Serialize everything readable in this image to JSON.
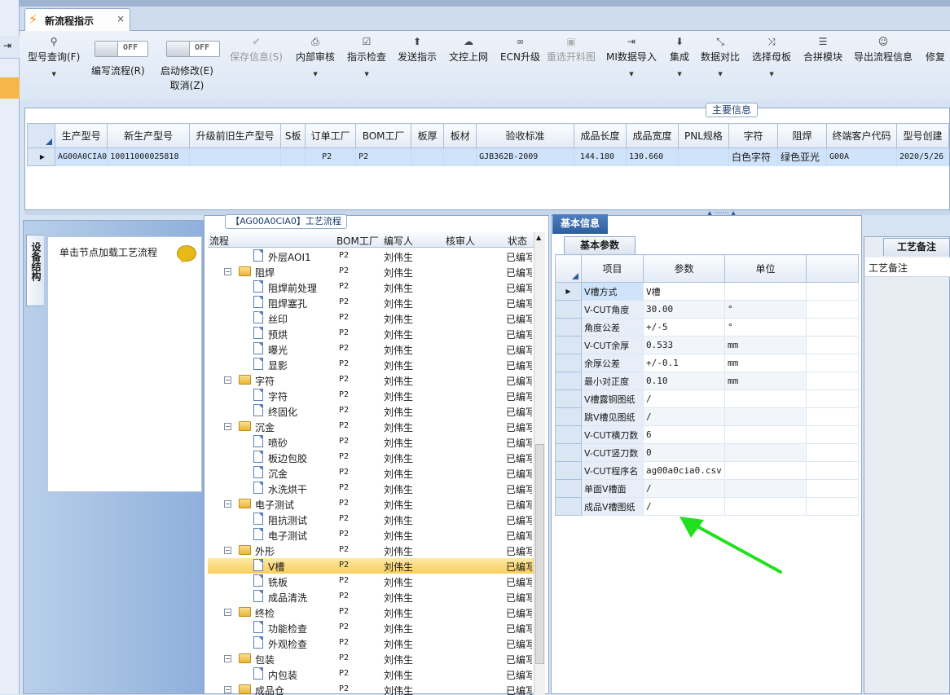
{
  "window": {
    "tab_title": "新流程指示",
    "tab_close": "×"
  },
  "toolbar": {
    "items": [
      {
        "label": "型号查询(F)",
        "icon": "search-icon"
      },
      {
        "label": "编写流程(R)",
        "icon": "toggle"
      },
      {
        "label": "启动修改(E)",
        "label2": "取消(Z)",
        "icon": "toggle"
      },
      {
        "label": "保存信息(S)",
        "icon": "check-icon",
        "disabled": true
      },
      {
        "label": "内部审核",
        "icon": "print-icon"
      },
      {
        "label": "指示检查",
        "icon": "checklist-icon"
      },
      {
        "label": "发送指示",
        "icon": "upload-icon"
      },
      {
        "label": "文控上网",
        "icon": "cloud-upload-icon"
      },
      {
        "label": "ECN升级",
        "icon": "binoculars-icon"
      },
      {
        "label": "重选开料图",
        "icon": "image-icon",
        "disabled": true
      },
      {
        "label": "MI数据导入",
        "icon": "import-icon"
      },
      {
        "label": "集成",
        "icon": "download-icon"
      },
      {
        "label": "数据对比",
        "icon": "compare-icon"
      },
      {
        "label": "选择母板",
        "icon": "shuffle-icon"
      },
      {
        "label": "合拼模块",
        "icon": "list-icon"
      },
      {
        "label": "导出流程信息",
        "icon": "smile-icon"
      },
      {
        "label": "修复",
        "icon": ""
      }
    ],
    "toggle_state": "OFF"
  },
  "main_info": {
    "title": "主要信息",
    "columns": [
      "生产型号",
      "新生产型号",
      "升级前旧生产型号",
      "S板",
      "订单工厂",
      "BOM工厂",
      "板厚",
      "板材",
      "验收标准",
      "成品长度",
      "成品宽度",
      "PNL规格",
      "字符",
      "阻焊",
      "终端客户代码",
      "型号创建"
    ],
    "row": [
      "AG00A0CIA0",
      "10011000025818",
      "",
      "",
      "P2",
      "P2",
      "",
      "",
      "GJB362B-2009",
      "144.180",
      "130.660",
      "",
      "白色字符",
      "绿色亚光",
      "G00A",
      "2020/5/26"
    ]
  },
  "left": {
    "side_tab": "设备结构",
    "node_hint": "单击节点加载工艺流程"
  },
  "process": {
    "title": "【AG00A0CIA0】工艺流程",
    "headers": [
      "流程",
      "BOM工厂",
      "编写人",
      "核审人",
      "状态"
    ],
    "rows": [
      {
        "name": "外层AOI1",
        "level": 2,
        "bom": "P2",
        "writer": "刘伟生",
        "status": "已编写"
      },
      {
        "name": "阻焊",
        "level": 1,
        "bom": "P2",
        "writer": "刘伟生",
        "status": "已编写"
      },
      {
        "name": "阻焊前处理",
        "level": 2,
        "bom": "P2",
        "writer": "刘伟生",
        "status": "已编写"
      },
      {
        "name": "阻焊塞孔",
        "level": 2,
        "bom": "P2",
        "writer": "刘伟生",
        "status": "已编写"
      },
      {
        "name": "丝印",
        "level": 2,
        "bom": "P2",
        "writer": "刘伟生",
        "status": "已编写"
      },
      {
        "name": "预烘",
        "level": 2,
        "bom": "P2",
        "writer": "刘伟生",
        "status": "已编写"
      },
      {
        "name": "曝光",
        "level": 2,
        "bom": "P2",
        "writer": "刘伟生",
        "status": "已编写"
      },
      {
        "name": "显影",
        "level": 2,
        "bom": "P2",
        "writer": "刘伟生",
        "status": "已编写"
      },
      {
        "name": "字符",
        "level": 1,
        "bom": "P2",
        "writer": "刘伟生",
        "status": "已编写"
      },
      {
        "name": "字符",
        "level": 2,
        "bom": "P2",
        "writer": "刘伟生",
        "status": "已编写"
      },
      {
        "name": "终固化",
        "level": 2,
        "bom": "P2",
        "writer": "刘伟生",
        "status": "已编写"
      },
      {
        "name": "沉金",
        "level": 1,
        "bom": "P2",
        "writer": "刘伟生",
        "status": "已编写"
      },
      {
        "name": "喷砂",
        "level": 2,
        "bom": "P2",
        "writer": "刘伟生",
        "status": "已编写"
      },
      {
        "name": "板边包胶",
        "level": 2,
        "bom": "P2",
        "writer": "刘伟生",
        "status": "已编写"
      },
      {
        "name": "沉金",
        "level": 2,
        "bom": "P2",
        "writer": "刘伟生",
        "status": "已编写"
      },
      {
        "name": "水洗烘干",
        "level": 2,
        "bom": "P2",
        "writer": "刘伟生",
        "status": "已编写"
      },
      {
        "name": "电子测试",
        "level": 1,
        "bom": "P2",
        "writer": "刘伟生",
        "status": "已编写"
      },
      {
        "name": "阻抗测试",
        "level": 2,
        "bom": "P2",
        "writer": "刘伟生",
        "status": "已编写"
      },
      {
        "name": "电子测试",
        "level": 2,
        "bom": "P2",
        "writer": "刘伟生",
        "status": "已编写"
      },
      {
        "name": "外形",
        "level": 1,
        "bom": "P2",
        "writer": "刘伟生",
        "status": "已编写"
      },
      {
        "name": "V槽",
        "level": 2,
        "bom": "P2",
        "writer": "刘伟生",
        "status": "已编写",
        "selected": true
      },
      {
        "name": "铣板",
        "level": 2,
        "bom": "P2",
        "writer": "刘伟生",
        "status": "已编写"
      },
      {
        "name": "成品清洗",
        "level": 2,
        "bom": "P2",
        "writer": "刘伟生",
        "status": "已编写"
      },
      {
        "name": "终检",
        "level": 1,
        "bom": "P2",
        "writer": "刘伟生",
        "status": "已编写"
      },
      {
        "name": "功能检查",
        "level": 2,
        "bom": "P2",
        "writer": "刘伟生",
        "status": "已编写"
      },
      {
        "name": "外观检查",
        "level": 2,
        "bom": "P2",
        "writer": "刘伟生",
        "status": "已编写"
      },
      {
        "name": "包装",
        "level": 1,
        "bom": "P2",
        "writer": "刘伟生",
        "status": "已编写"
      },
      {
        "name": "内包装",
        "level": 2,
        "bom": "P2",
        "writer": "刘伟生",
        "status": "已编写"
      },
      {
        "name": "成品仓",
        "level": 1,
        "bom": "P2",
        "writer": "刘伟生",
        "status": "已编写"
      }
    ]
  },
  "basic": {
    "tab": "基本信息",
    "subtab": "基本参数",
    "headers": [
      "项目",
      "参数",
      "单位"
    ],
    "rows": [
      [
        "V槽方式",
        "V槽",
        ""
      ],
      [
        "V-CUT角度",
        "30.00",
        "°"
      ],
      [
        "角度公差",
        "+/-5",
        "°"
      ],
      [
        "V-CUT余厚",
        "0.533",
        "mm"
      ],
      [
        "余厚公差",
        "+/-0.1",
        "mm"
      ],
      [
        "最小对正度",
        "0.10",
        "mm"
      ],
      [
        "V槽露铜图纸",
        "/",
        ""
      ],
      [
        "跳V槽见图纸",
        "/",
        ""
      ],
      [
        "V-CUT横刀数",
        "6",
        ""
      ],
      [
        "V-CUT竖刀数",
        "0",
        ""
      ],
      [
        "V-CUT程序名",
        "ag00a0cia0.csv",
        ""
      ],
      [
        "单面V槽面",
        "/",
        ""
      ],
      [
        "成品V槽图纸",
        "/",
        ""
      ]
    ]
  },
  "notes": {
    "tab": "工艺备注",
    "header": "工艺备注"
  },
  "colors": {
    "accent": "#2c5e9f",
    "selection": "#f8cd5c",
    "arrow": "#22e01f"
  }
}
